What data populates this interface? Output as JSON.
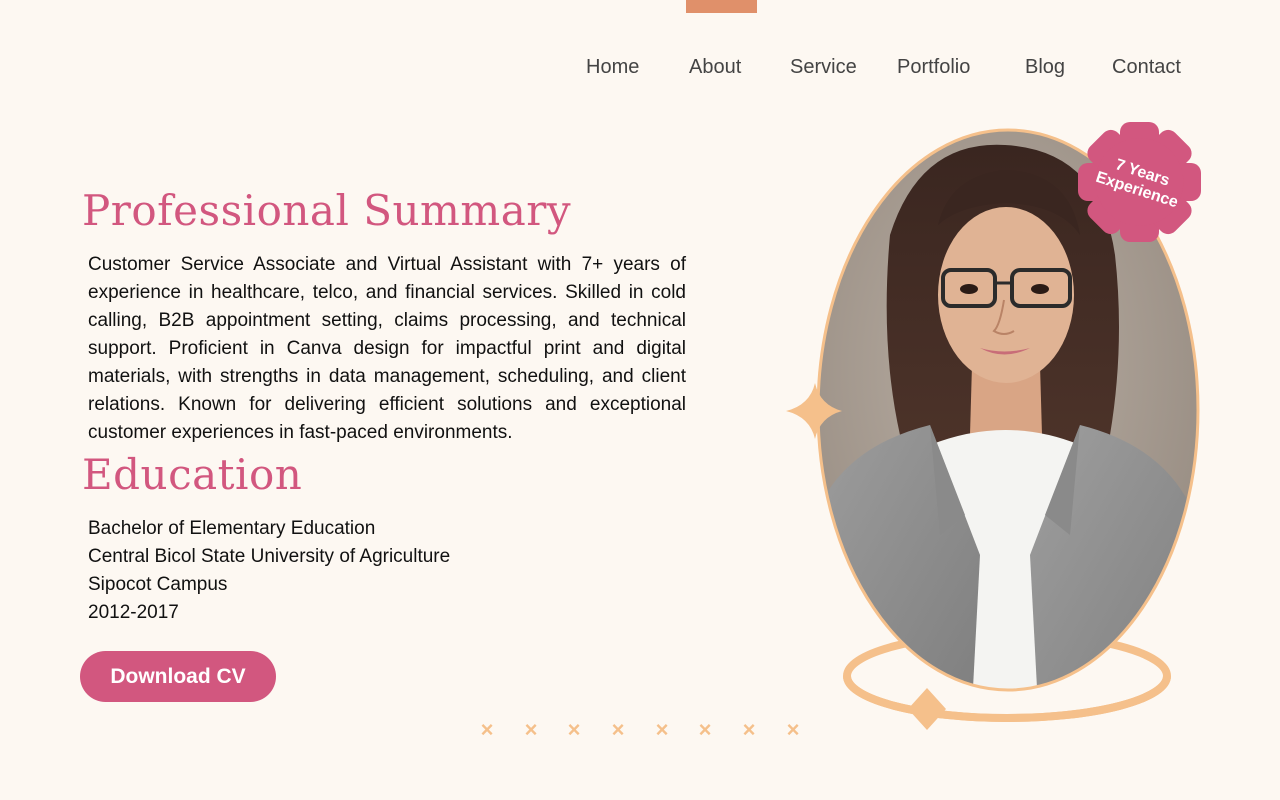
{
  "nav": {
    "items": [
      "Home",
      "About",
      "Service",
      "Portfolio",
      "Blog",
      "Contact"
    ]
  },
  "summary": {
    "heading": "Professional Summary",
    "body": "Customer Service Associate and Virtual Assistant with 7+ years of experience in healthcare, telco, and financial services. Skilled in cold calling, B2B appointment setting, claims processing, and technical support. Proficient in Canva design for impactful print and digital materials, with strengths in data management, scheduling, and client relations. Known for delivering efficient solutions and exceptional customer experiences in fast-paced environments."
  },
  "education": {
    "heading": "Education",
    "lines": [
      "Bachelor of Elementary Education",
      "Central Bicol State University of Agriculture",
      "Sipocot Campus",
      "2012-2017"
    ]
  },
  "cta": {
    "download_label": "Download CV"
  },
  "badge": {
    "line1": "7 Years",
    "line2": "Experience"
  },
  "decor": {
    "marks": [
      "×",
      "×",
      "×",
      "×",
      "×",
      "×",
      "×",
      "×"
    ]
  },
  "colors": {
    "background": "#fdf8f2",
    "accent_pink": "#d2577f",
    "accent_peach": "#f5c08b",
    "top_tab": "#e0906a",
    "nav_text": "#444444"
  },
  "icons": {
    "sparkle": "four-point-star-icon",
    "badge_shape": "scalloped-badge-icon",
    "decor_mark": "cross-mark-icon"
  }
}
